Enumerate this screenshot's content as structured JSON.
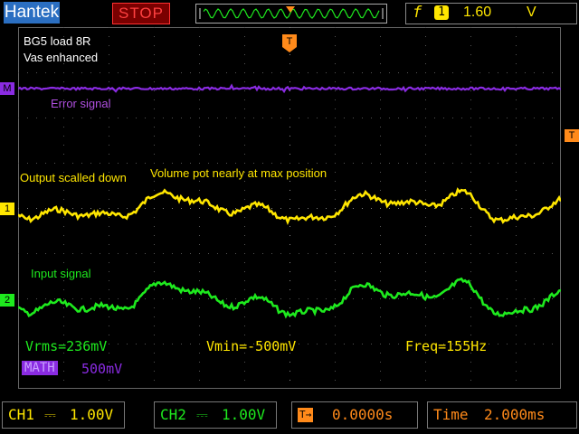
{
  "top_bar": {
    "brand": "Hantek",
    "run_state": "STOP",
    "trigger_edge_symbol": "f",
    "trigger_source": "1",
    "trigger_level": "1.60",
    "trigger_unit": "V"
  },
  "notes": {
    "line1": "BG5 load 8R",
    "line2": "Vas enhanced",
    "error": "Error signal",
    "output": "Output scalled down",
    "volume": "Volume pot nearly at max position",
    "input": "Input signal"
  },
  "measurements": {
    "vrms": "Vrms=236mV",
    "vmin": "Vmin=-500mV",
    "freq": "Freq=155Hz",
    "math_label": "MATH",
    "math_scale": "500mV"
  },
  "bottom_bar": {
    "ch1_label": "CH1",
    "ch1_coupling": "⎓",
    "ch1_scale": "1.00V",
    "ch2_label": "CH2",
    "ch2_coupling": "⎓",
    "ch2_scale": "1.00V",
    "trigger_pos_icon": "T→",
    "trigger_pos": "0.0000s",
    "timebase_label": "Time",
    "timebase": "2.000ms"
  },
  "markers": {
    "math": "M",
    "ch1": "1",
    "ch2": "2",
    "trigger_top": "T",
    "trigger_level": "T"
  },
  "colors": {
    "ch1": "#ffe600",
    "ch2": "#1eea1e",
    "math": "#8a2be2",
    "trigger": "#ff8a1a",
    "stop": "#ff4040",
    "brand": "#2b6fc2"
  },
  "icons": {
    "memory": "waveform-memory-bar",
    "trigger_edge": "rising-edge-icon",
    "coupling": "dc-coupling-icon"
  }
}
